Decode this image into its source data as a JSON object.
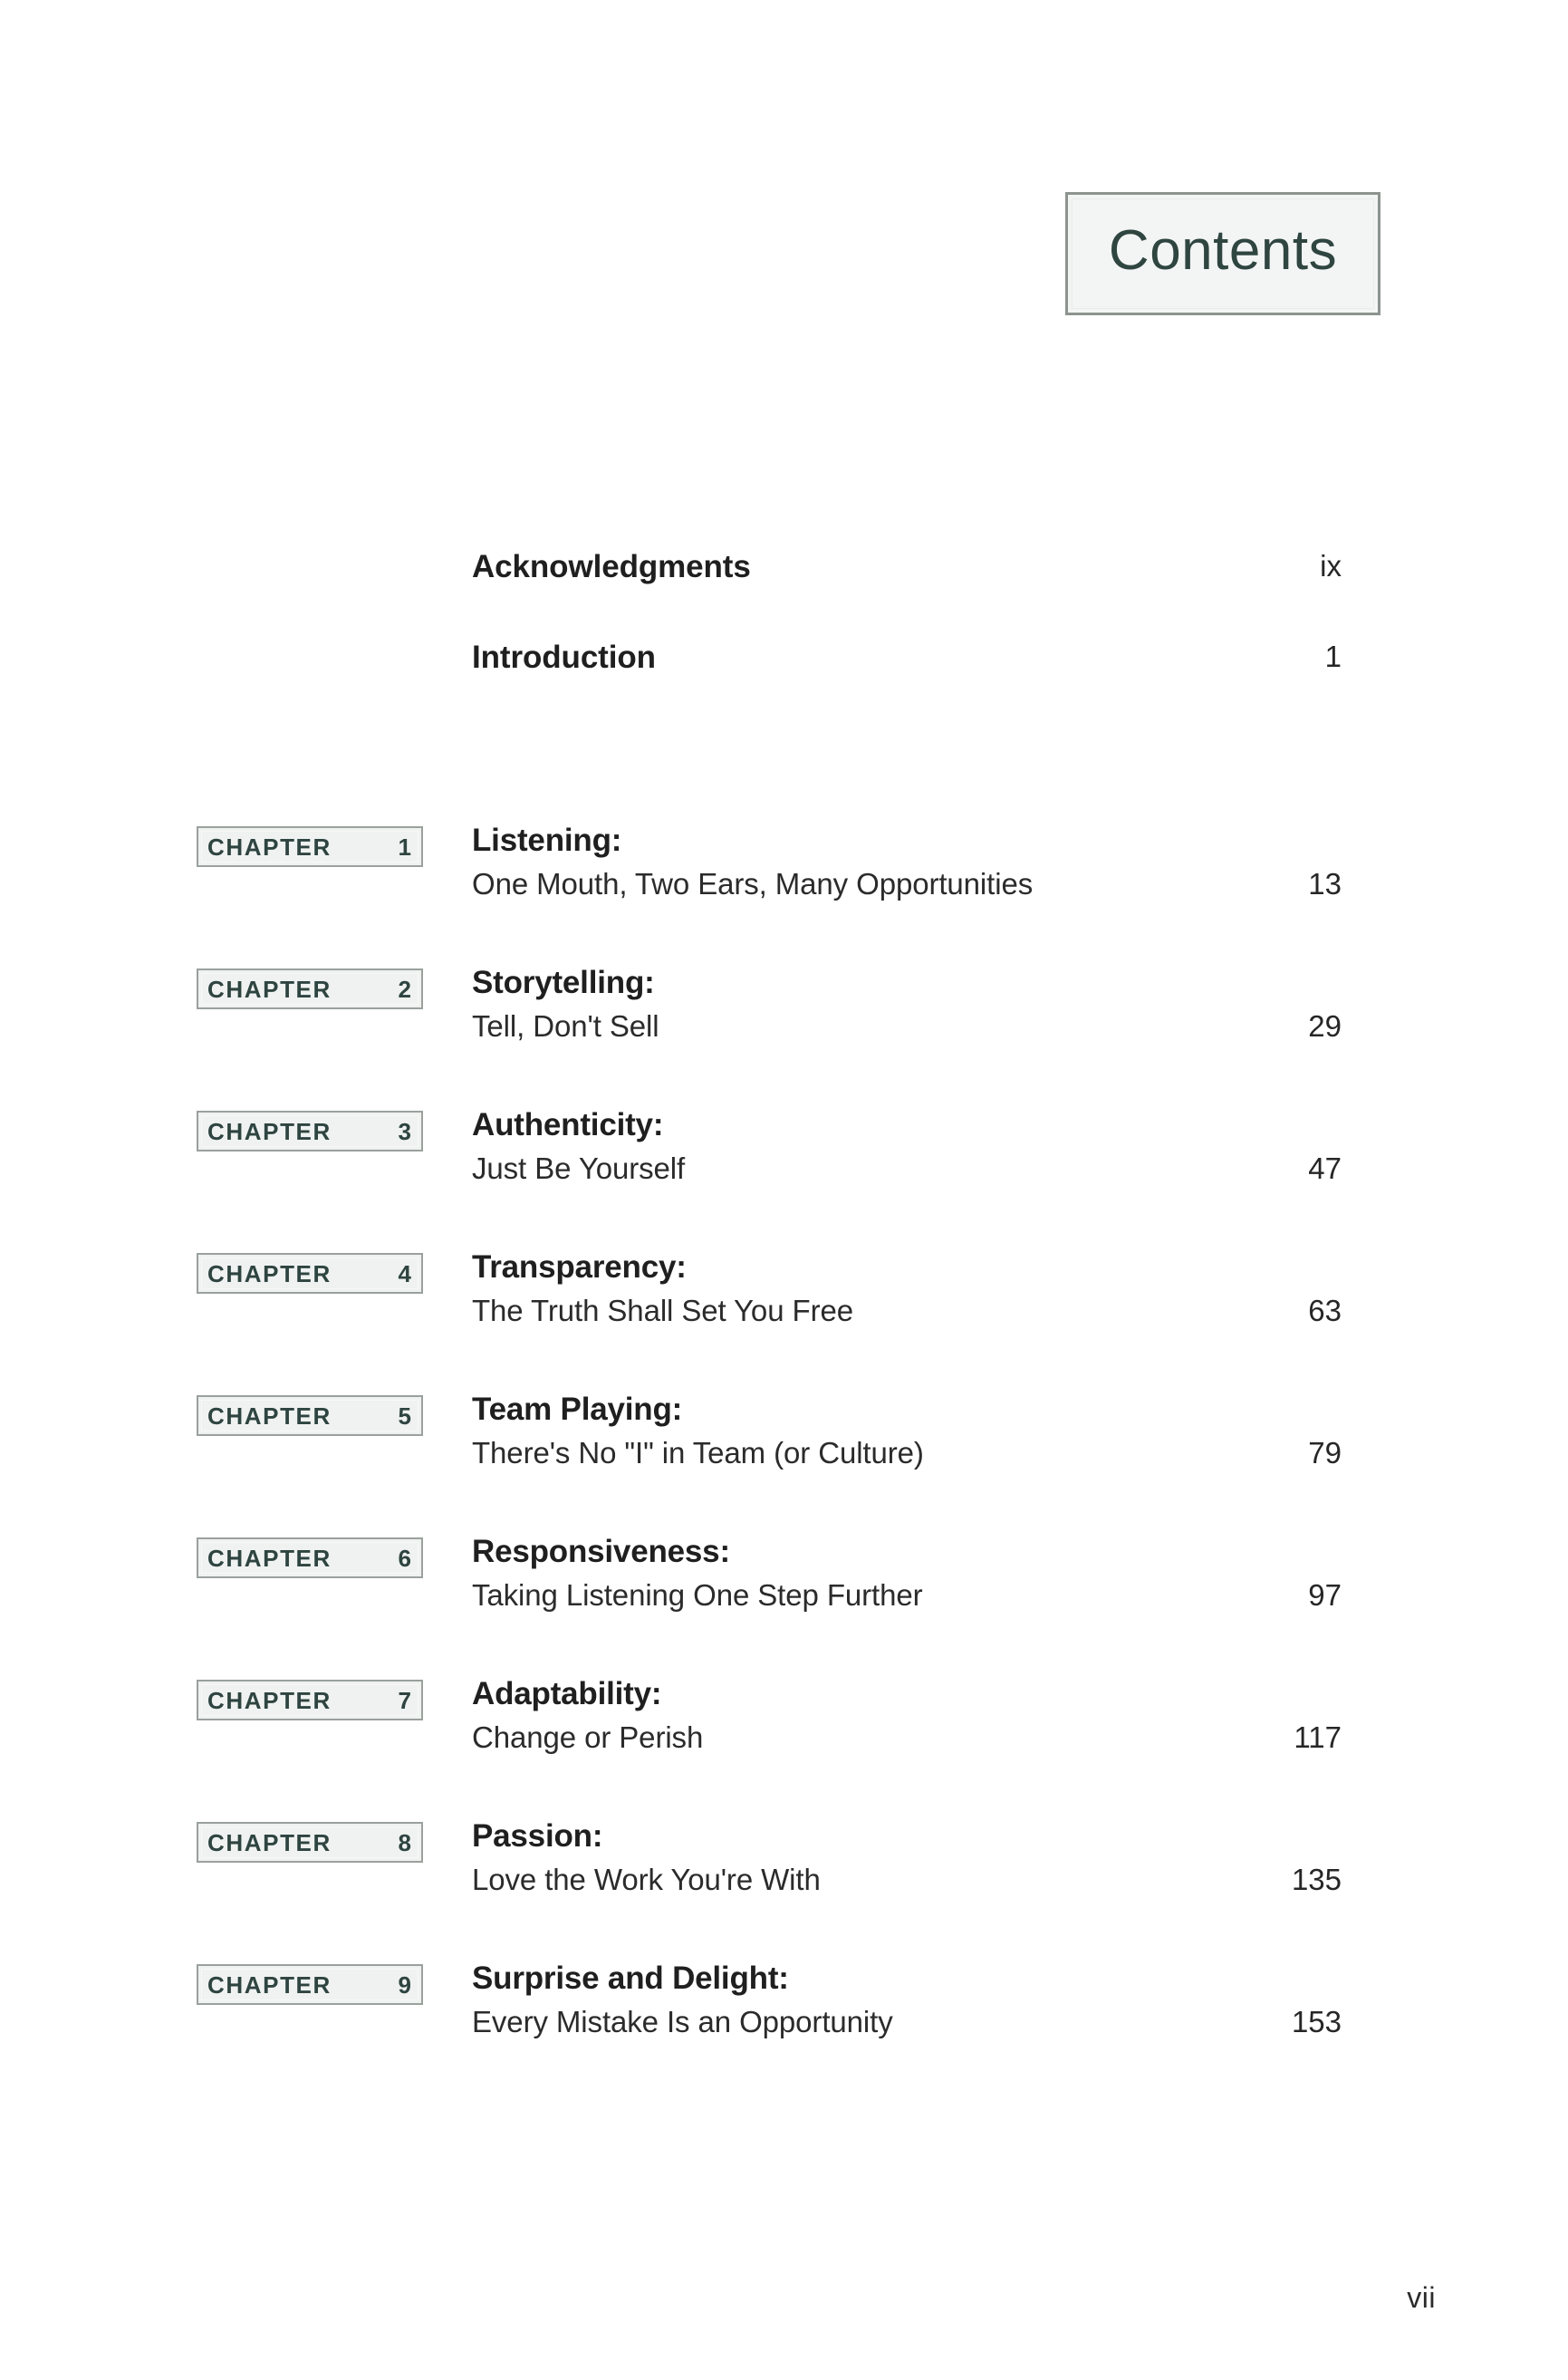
{
  "heading": {
    "title": "Contents"
  },
  "front_matter": [
    {
      "label": "Acknowledgments",
      "page": "ix"
    },
    {
      "label": "Introduction",
      "page": "1"
    }
  ],
  "chapter_label_word": "CHAPTER",
  "chapters": [
    {
      "number": "1",
      "title": "Listening:",
      "subtitle": "One Mouth, Two Ears, Many Opportunities",
      "page": "13"
    },
    {
      "number": "2",
      "title": "Storytelling:",
      "subtitle": "Tell, Don't Sell",
      "page": "29"
    },
    {
      "number": "3",
      "title": "Authenticity:",
      "subtitle": "Just Be Yourself",
      "page": "47"
    },
    {
      "number": "4",
      "title": "Transparency:",
      "subtitle": "The Truth Shall Set You Free",
      "page": "63"
    },
    {
      "number": "5",
      "title": "Team Playing:",
      "subtitle": "There's No \"I\" in Team (or Culture)",
      "page": "79"
    },
    {
      "number": "6",
      "title": "Responsiveness:",
      "subtitle": "Taking Listening One Step Further",
      "page": "97"
    },
    {
      "number": "7",
      "title": "Adaptability:",
      "subtitle": "Change or Perish",
      "page": "117"
    },
    {
      "number": "8",
      "title": "Passion:",
      "subtitle": "Love the Work You're With",
      "page": "135"
    },
    {
      "number": "9",
      "title": "Surprise and Delight:",
      "subtitle": "Every Mistake Is an Opportunity",
      "page": "153"
    }
  ],
  "folio": "vii",
  "colors": {
    "heading_text": "#2f4540",
    "chapter_tag_text": "#2e4440",
    "body_text": "#1f1f1f",
    "tag_border": "#9aa19d",
    "tag_fill": "#eff2f0"
  }
}
